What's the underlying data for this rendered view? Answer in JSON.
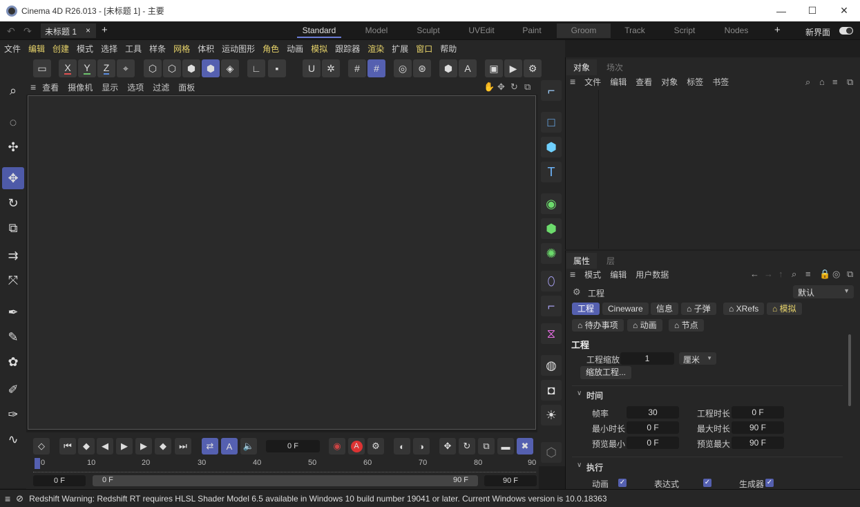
{
  "window": {
    "title": "Cinema 4D R26.013 - [未标题 1] - 主要",
    "controls": [
      "—",
      "☐",
      "✕"
    ]
  },
  "doc_tab": {
    "label": "未标题 1",
    "close": "×",
    "add": "+"
  },
  "layouts": [
    {
      "label": "Standard",
      "state": "active"
    },
    {
      "label": "Model",
      "state": ""
    },
    {
      "label": "Sculpt",
      "state": ""
    },
    {
      "label": "UVEdit",
      "state": ""
    },
    {
      "label": "Paint",
      "state": ""
    },
    {
      "label": "Groom",
      "state": "sel"
    },
    {
      "label": "Track",
      "state": ""
    },
    {
      "label": "Script",
      "state": ""
    },
    {
      "label": "Nodes",
      "state": ""
    }
  ],
  "layout_add": "+",
  "new_ui_label": "新界面",
  "menu": [
    {
      "label": "文件",
      "y": false
    },
    {
      "label": "编辑",
      "y": true
    },
    {
      "label": "创建",
      "y": true
    },
    {
      "label": "模式",
      "y": false
    },
    {
      "label": "选择",
      "y": false
    },
    {
      "label": "工具",
      "y": false
    },
    {
      "label": "样条",
      "y": false
    },
    {
      "label": "网格",
      "y": true
    },
    {
      "label": "体积",
      "y": false
    },
    {
      "label": "运动图形",
      "y": false
    },
    {
      "label": "角色",
      "y": true
    },
    {
      "label": "动画",
      "y": false
    },
    {
      "label": "模拟",
      "y": true
    },
    {
      "label": "跟踪器",
      "y": false
    },
    {
      "label": "渲染",
      "y": true
    },
    {
      "label": "扩展",
      "y": false
    },
    {
      "label": "窗口",
      "y": true
    },
    {
      "label": "帮助",
      "y": false
    }
  ],
  "axis": {
    "x": "X",
    "y": "Y",
    "z": "Z",
    "x_color": "#e05050",
    "y_color": "#6cc46c",
    "z_color": "#5a8de0"
  },
  "viewport_menu": [
    "查看",
    "摄像机",
    "显示",
    "选项",
    "过滤",
    "面板"
  ],
  "timeline": {
    "current_frame": "0 F",
    "ticks": [
      "0",
      "10",
      "20",
      "30",
      "40",
      "50",
      "60",
      "70",
      "80",
      "90"
    ],
    "start_field": "0 F",
    "range_start": "0 F",
    "range_end": "90 F",
    "end_field": "90 F",
    "record_label": "A"
  },
  "status": "Redshift Warning: Redshift RT requires HLSL Shader Model 6.5 available in Windows 10 build number 19041 or later. Current Windows version is 10.0.18363",
  "objects_panel": {
    "tabs": [
      "对象",
      "场次"
    ],
    "menu": [
      "文件",
      "编辑",
      "查看",
      "对象",
      "标签",
      "书签"
    ]
  },
  "attributes_panel": {
    "tabs": [
      "属性",
      "层"
    ],
    "menu": [
      "模式",
      "编辑",
      "用户数据"
    ],
    "object_label": "工程",
    "preset": "默认",
    "chips_row1": [
      "工程",
      "Cineware",
      "信息",
      "子弹",
      "XRefs",
      "模拟"
    ],
    "chips_row2": [
      "待办事项",
      "动画",
      "节点"
    ],
    "section_title": "工程",
    "scale_label": "工程缩放",
    "scale_value": "1",
    "scale_unit": "厘米",
    "scale_button": "缩放工程...",
    "time_section": "时间",
    "fps_label": "帧率",
    "fps": "30",
    "duration_label": "工程时长",
    "duration": "0 F",
    "min_label": "最小时长",
    "min": "0 F",
    "max_label": "最大时长",
    "max": "90 F",
    "pmin_label": "预览最小",
    "pmin": "0 F",
    "pmax_label": "预览最大",
    "pmax": "90 F",
    "exec_section": "执行",
    "anim_label": "动画",
    "expr_label": "表达式",
    "gen_label": "生成器",
    "check": "✓"
  }
}
